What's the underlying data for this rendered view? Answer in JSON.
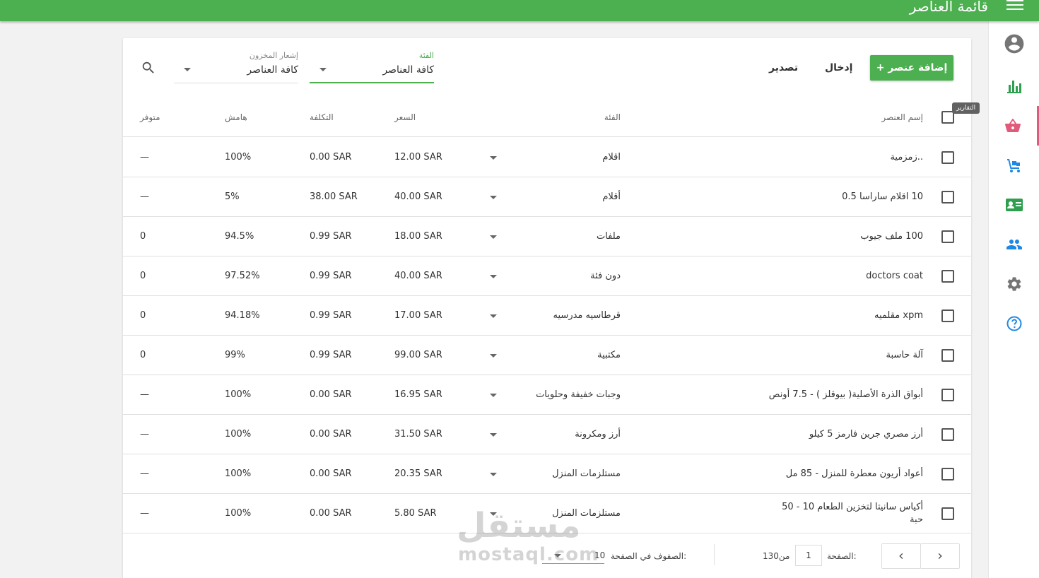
{
  "header": {
    "title": "قائمة العناصر"
  },
  "sidebar": {
    "tooltip": "التقارير"
  },
  "toolbar": {
    "add_label": "+ إضافة عنصر",
    "import_label": "إدخال",
    "export_label": "تصدير",
    "category_filter": {
      "label": "الفئة",
      "value": "كافة العناصر"
    },
    "stock_filter": {
      "label": "إشعار المخزون",
      "value": "كافة العناصر"
    }
  },
  "table": {
    "headers": {
      "name": "إسم العنصر",
      "category": "الفئة",
      "price": "السعر",
      "cost": "التكلفة",
      "margin": "هامش",
      "available": "متوفر"
    },
    "rows": [
      {
        "name": "..زمزمية",
        "category": "اقلام",
        "price": "12.00 SAR",
        "cost": "0.00 SAR",
        "margin": "100%",
        "available": "—"
      },
      {
        "name": "10 اقلام ساراسا 0.5",
        "category": "أقلام",
        "price": "40.00 SAR",
        "cost": "38.00 SAR",
        "margin": "5%",
        "available": "—"
      },
      {
        "name": "100 ملف جيوب",
        "category": "ملفات",
        "price": "18.00 SAR",
        "cost": "0.99 SAR",
        "margin": "94.5%",
        "available": "0"
      },
      {
        "name": "doctors coat",
        "category": "دون فئة",
        "price": "40.00 SAR",
        "cost": "0.99 SAR",
        "margin": "97.52%",
        "available": "0"
      },
      {
        "name": "xpm مقلميه",
        "category": "قرطاسيه مدرسيه",
        "price": "17.00 SAR",
        "cost": "0.99 SAR",
        "margin": "94.18%",
        "available": "0"
      },
      {
        "name": "آلة حاسبة",
        "category": "مكتبية",
        "price": "99.00 SAR",
        "cost": "0.99 SAR",
        "margin": "99%",
        "available": "0"
      },
      {
        "name": "أبواق الذرة الأصلية( بيوقلز ) - 7.5 أونص",
        "category": "وجبات خفيفة وحلويات",
        "price": "16.95 SAR",
        "cost": "0.00 SAR",
        "margin": "100%",
        "available": "—"
      },
      {
        "name": "أرز مصري جرين فارمز 5 كيلو",
        "category": "أرز ومكرونة",
        "price": "31.50 SAR",
        "cost": "0.00 SAR",
        "margin": "100%",
        "available": "—"
      },
      {
        "name": "أعواد أريون معطرة للمنزل - 85 مل",
        "category": "مستلزمات المنزل",
        "price": "20.35 SAR",
        "cost": "0.00 SAR",
        "margin": "100%",
        "available": "—"
      },
      {
        "name": "أكياس سانيتا لتخزين الطعام 10 - 50 حبة",
        "category": "مستلزمات المنزل",
        "price": "5.80 SAR",
        "cost": "0.00 SAR",
        "margin": "100%",
        "available": "—"
      }
    ]
  },
  "footer": {
    "page_label": "الصفحة:",
    "page_value": "1",
    "of_label": "130من",
    "rows_per_page_label": "الصفوف في الصفحة:",
    "rows_per_page_value": "10"
  },
  "watermark": {
    "arabic": "مستقل",
    "latin": "mostaql.com"
  },
  "colors": {
    "primary": "#4caf50",
    "accent_pink": "#e05a7a",
    "icon_blue": "#1e88e5",
    "icon_green": "#2e9e4f",
    "icon_gray": "#757575"
  },
  "icons": [
    "menu-icon",
    "account-circle-icon",
    "bar-chart-icon",
    "basket-icon",
    "dolly-icon",
    "id-card-icon",
    "people-icon",
    "gear-icon",
    "help-icon",
    "search-icon",
    "chevron-left-icon",
    "chevron-right-icon"
  ]
}
